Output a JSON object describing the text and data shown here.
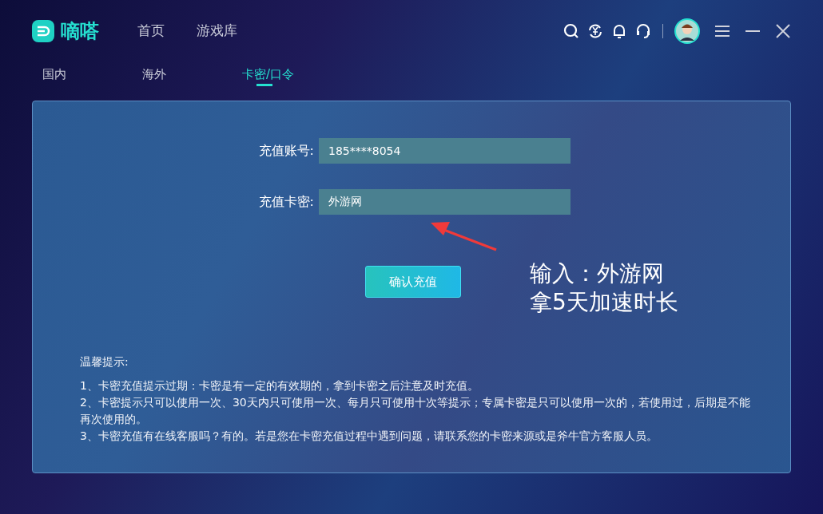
{
  "app": {
    "logo_text": "嘀嗒"
  },
  "nav": [
    {
      "label": "首页",
      "selected": false
    },
    {
      "label": "游戏库",
      "selected": false
    }
  ],
  "tabs": [
    {
      "label": "国内",
      "selected": false
    },
    {
      "label": "海外",
      "selected": false
    },
    {
      "label": "卡密/口令",
      "selected": true
    }
  ],
  "form": {
    "fields": [
      {
        "label": "充值账号:",
        "value": "185****8054"
      },
      {
        "label": "充值卡密:",
        "value": "外游网"
      }
    ],
    "submit": "确认充值"
  },
  "annotation": {
    "lines": [
      "输入：外游网",
      "拿5天加速时长"
    ]
  },
  "tips": {
    "title": "温馨提示:",
    "items": [
      "1、卡密充值提示过期：卡密是有一定的有效期的，拿到卡密之后注意及时充值。",
      "2、卡密提示只可以使用一次、30天内只可使用一次、每月只可使用十次等提示；专属卡密是只可以使用一次的，若使用过，后期是不能再次使用的。",
      "3、卡密充值有在线客服吗？有的。若是您在卡密充值过程中遇到问题，请联系您的卡密来源或是斧牛官方客服人员。"
    ]
  }
}
